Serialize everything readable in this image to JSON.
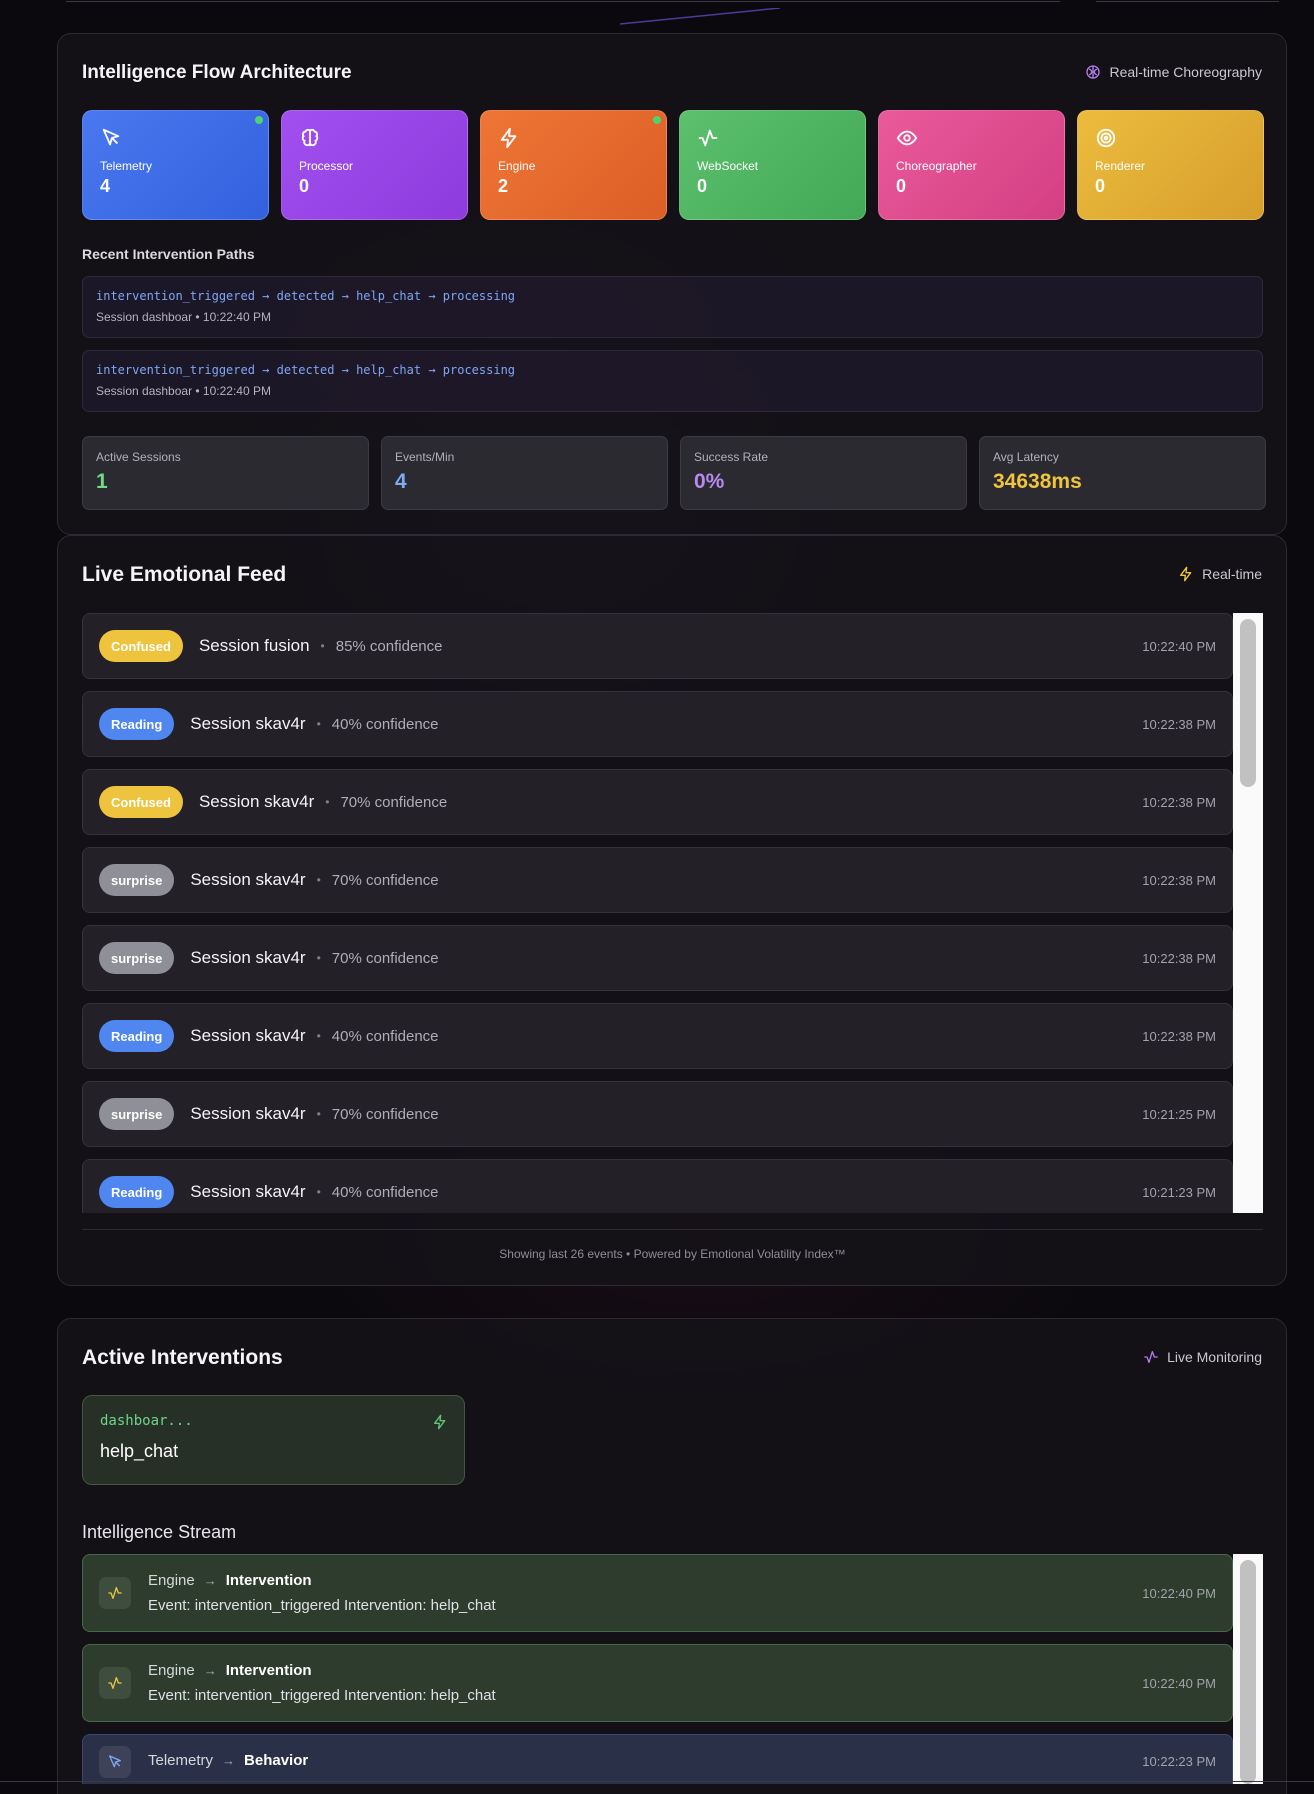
{
  "flow": {
    "title": "Intelligence Flow Architecture",
    "tag": "Real-time Choreography",
    "cards": [
      {
        "label": "Telemetry",
        "value": "4",
        "icon": "cursor-icon",
        "active": true
      },
      {
        "label": "Processor",
        "value": "0",
        "icon": "brain-icon",
        "active": false
      },
      {
        "label": "Engine",
        "value": "2",
        "icon": "lightning-icon",
        "active": true
      },
      {
        "label": "WebSocket",
        "value": "0",
        "icon": "activity-icon",
        "active": false
      },
      {
        "label": "Choreographer",
        "value": "0",
        "icon": "eye-icon",
        "active": false
      },
      {
        "label": "Renderer",
        "value": "0",
        "icon": "target-icon",
        "active": false
      }
    ],
    "paths_heading": "Recent Intervention Paths",
    "paths": [
      {
        "code": "intervention_triggered → detected → help_chat → processing",
        "meta": "Session dashboar • 10:22:40 PM"
      },
      {
        "code": "intervention_triggered → detected → help_chat → processing",
        "meta": "Session dashboar • 10:22:40 PM"
      }
    ],
    "stats": [
      {
        "label": "Active Sessions",
        "value": "1",
        "color": "#6fdc85"
      },
      {
        "label": "Events/Min",
        "value": "4",
        "color": "#7fa8f6"
      },
      {
        "label": "Success Rate",
        "value": "0%",
        "color": "#b78af2"
      },
      {
        "label": "Avg Latency",
        "value": "34638ms",
        "color": "#efc43e"
      }
    ]
  },
  "feed": {
    "title": "Live Emotional Feed",
    "tag": "Real-time",
    "events": [
      {
        "emotion": "Confused",
        "session": "Session fusion",
        "confidence": "85% confidence",
        "time": "10:22:40 PM"
      },
      {
        "emotion": "Reading",
        "session": "Session skav4r",
        "confidence": "40% confidence",
        "time": "10:22:38 PM"
      },
      {
        "emotion": "Confused",
        "session": "Session skav4r",
        "confidence": "70% confidence",
        "time": "10:22:38 PM"
      },
      {
        "emotion": "surprise",
        "session": "Session skav4r",
        "confidence": "70% confidence",
        "time": "10:22:38 PM"
      },
      {
        "emotion": "surprise",
        "session": "Session skav4r",
        "confidence": "70% confidence",
        "time": "10:22:38 PM"
      },
      {
        "emotion": "Reading",
        "session": "Session skav4r",
        "confidence": "40% confidence",
        "time": "10:22:38 PM"
      },
      {
        "emotion": "surprise",
        "session": "Session skav4r",
        "confidence": "70% confidence",
        "time": "10:21:25 PM"
      },
      {
        "emotion": "Reading",
        "session": "Session skav4r",
        "confidence": "40% confidence",
        "time": "10:21:23 PM"
      }
    ],
    "footer": "Showing last 26 events • Powered by Emotional Volatility Index™"
  },
  "interventions": {
    "title": "Active Interventions",
    "tag": "Live Monitoring",
    "card": {
      "session": "dashboar...",
      "name": "help_chat"
    },
    "stream_heading": "Intelligence Stream",
    "stream": [
      {
        "from": "Engine",
        "to": "Intervention",
        "detail": "Event: intervention_triggered Intervention: help_chat",
        "time": "10:22:40 PM",
        "kind": "green"
      },
      {
        "from": "Engine",
        "to": "Intervention",
        "detail": "Event: intervention_triggered Intervention: help_chat",
        "time": "10:22:40 PM",
        "kind": "green"
      },
      {
        "from": "Telemetry",
        "to": "Behavior",
        "detail": "",
        "time": "10:22:23 PM",
        "kind": "blue"
      }
    ]
  },
  "colors": {
    "telemetry": "#3f6ee6",
    "processor": "#9b45e6",
    "engine": "#e8692c",
    "websocket": "#4db460",
    "choreographer": "#de4b8f",
    "renderer": "#e3ad35"
  }
}
